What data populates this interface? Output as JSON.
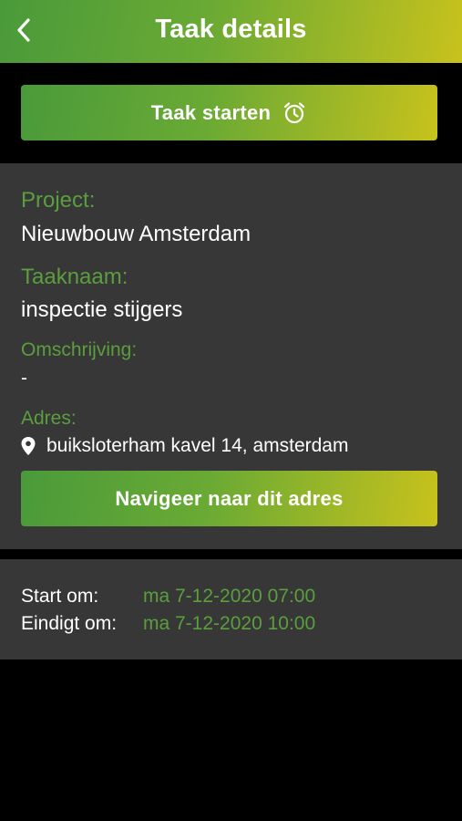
{
  "header": {
    "title": "Taak details",
    "back_icon": "chevron-left-icon"
  },
  "start_button": {
    "label": "Taak starten",
    "icon": "alarm-clock-icon"
  },
  "details": {
    "project_label": "Project:",
    "project_value": "Nieuwbouw Amsterdam",
    "taskname_label": "Taaknaam:",
    "taskname_value": "inspectie stijgers",
    "description_label": "Omschrijving:",
    "description_value": "-",
    "address_label": "Adres:",
    "address_icon": "location-pin-icon",
    "address_value": "buiksloterham kavel 14, amsterdam",
    "navigate_label": "Navigeer naar dit adres"
  },
  "times": {
    "start_label": "Start om:",
    "start_value": "ma 7-12-2020 07:00",
    "end_label": "Eindigt om:",
    "end_value": "ma 7-12-2020 10:00"
  },
  "colors": {
    "accent_green": "#5a9e3e",
    "gradient_start": "#4a9a3a",
    "gradient_end": "#c8c21c",
    "card_bg": "#373737",
    "page_bg": "#000000"
  }
}
